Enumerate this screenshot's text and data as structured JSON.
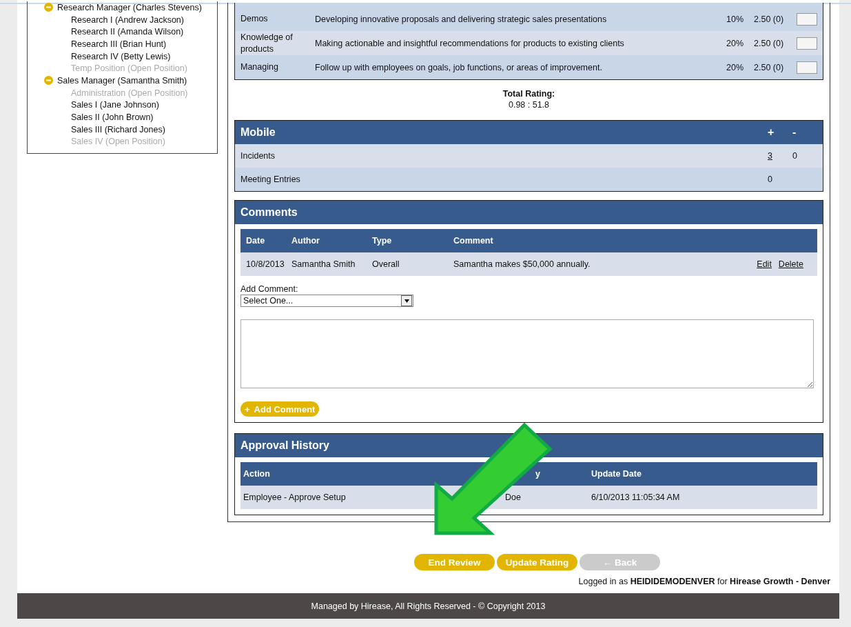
{
  "org_tree": [
    {
      "label": "Research Manager (Charles Stevens)",
      "expanded": true,
      "open_position": false,
      "children": [
        {
          "label": "Research I (Andrew Jackson)",
          "open_position": false
        },
        {
          "label": "Research II (Amanda Wilson)",
          "open_position": false
        },
        {
          "label": "Research III (Brian Hunt)",
          "open_position": false
        },
        {
          "label": "Research IV (Betty Lewis)",
          "open_position": false
        },
        {
          "label": "Temp Position (Open Position)",
          "open_position": true
        }
      ]
    },
    {
      "label": "Sales Manager (Samantha Smith)",
      "expanded": true,
      "open_position": false,
      "children": [
        {
          "label": "Administration (Open Position)",
          "open_position": true
        },
        {
          "label": "Sales I (Jane Johnson)",
          "open_position": false
        },
        {
          "label": "Sales II (John Brown)",
          "open_position": false
        },
        {
          "label": "Sales III (Richard Jones)",
          "open_position": false
        },
        {
          "label": "Sales IV (Open Position)",
          "open_position": true
        }
      ]
    }
  ],
  "rating_table": {
    "rows": [
      {
        "competency": "Demos",
        "description": "Developing innovative proposals and delivering strategic sales presentations",
        "weight": "10%",
        "score": "2.50 (0)"
      },
      {
        "competency": "Knowledge of products",
        "description": "Making actionable and insightful recommendations for products to existing clients",
        "weight": "20%",
        "score": "2.50 (0)"
      },
      {
        "competency": "Managing",
        "description": "Follow up with employees on goals, job functions, or areas of improvement.",
        "weight": "20%",
        "score": "2.50 (0)"
      }
    ]
  },
  "total_rating": {
    "label": "Total Rating:",
    "value": "0.98 : 51.8"
  },
  "mobile": {
    "title": "Mobile",
    "plus_label": "+",
    "minus_label": "-",
    "rows": [
      {
        "label": "Incidents",
        "plus": "3",
        "plus_link": true,
        "minus": "0"
      },
      {
        "label": "Meeting Entries",
        "plus": "0",
        "plus_link": false
      }
    ]
  },
  "comments": {
    "title": "Comments",
    "columns": [
      "Date",
      "Author",
      "Type",
      "Comment"
    ],
    "rows": [
      {
        "date": "10/8/2013",
        "author": "Samantha Smith",
        "type": "Overall",
        "comment": "Samantha makes $50,000 annually.",
        "actions": [
          "Edit",
          "Delete"
        ]
      }
    ],
    "add_label": "Add Comment:",
    "select": {
      "value": "Select One..."
    },
    "add_button": {
      "icon": "+",
      "label": "Add Comment"
    }
  },
  "approval": {
    "title": "Approval History",
    "columns": [
      "Action",
      "y",
      "Update Date"
    ],
    "rows": [
      {
        "action": "Employee - Approve Setup",
        "column_2": "Doe",
        "update_date": "6/10/2013 11:05:34 AM"
      }
    ]
  },
  "buttons": [
    {
      "label": "End Review",
      "disabled": false
    },
    {
      "label": "Update Rating",
      "disabled": false
    },
    {
      "label": "← Back",
      "disabled": true
    }
  ],
  "login": "Logged in as **HEIDIDEMODENVER** for **Hirease Growth - Denver**",
  "footer": "Managed by Hirease, All Rights Reserved - © Copyright 2013"
}
